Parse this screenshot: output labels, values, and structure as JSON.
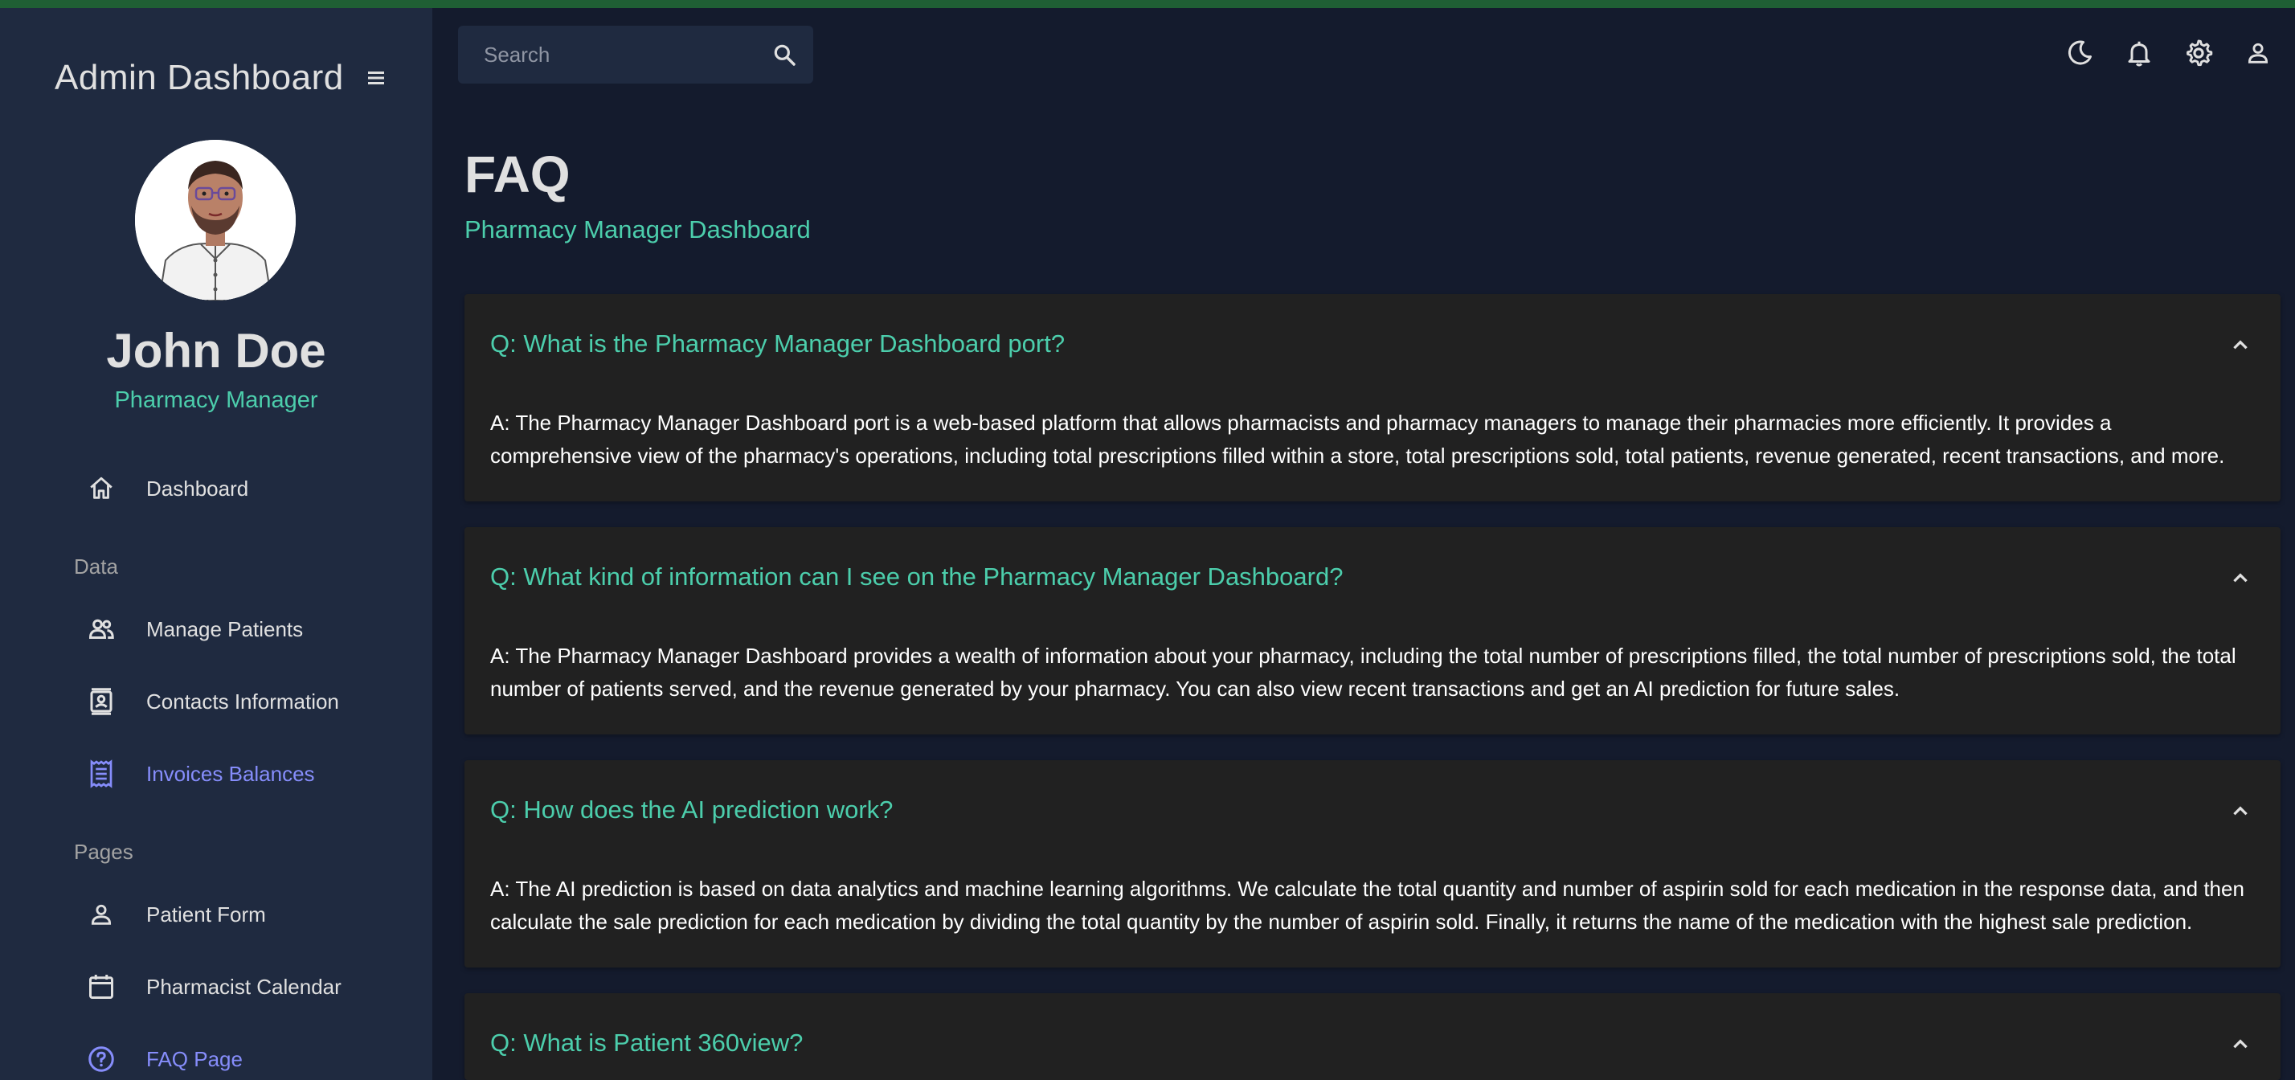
{
  "sidebar": {
    "title": "Admin Dashboard",
    "user": {
      "name": "John Doe",
      "role": "Pharmacy Manager"
    },
    "nav": {
      "dashboard": "Dashboard",
      "section_data": "Data",
      "manage_patients": "Manage Patients",
      "contacts": "Contacts Information",
      "invoices": "Invoices Balances",
      "section_pages": "Pages",
      "patient_form": "Patient Form",
      "calendar": "Pharmacist Calendar",
      "faq": "FAQ Page"
    },
    "active_item": "Invoices Balances"
  },
  "topbar": {
    "search_placeholder": "Search",
    "icons": [
      "moon-icon",
      "bell-icon",
      "gear-icon",
      "person-icon"
    ]
  },
  "header": {
    "title": "FAQ",
    "subtitle": "Pharmacy Manager Dashboard"
  },
  "faqs": [
    {
      "question": "Q: What is the Pharmacy Manager Dashboard port?",
      "answer": "A: The Pharmacy Manager Dashboard port is a web-based platform that allows pharmacists and pharmacy managers to manage their pharmacies more efficiently. It provides a comprehensive view of the pharmacy's operations, including total prescriptions filled within a store, total prescriptions sold, total patients, revenue generated, recent transactions, and more."
    },
    {
      "question": "Q: What kind of information can I see on the Pharmacy Manager Dashboard?",
      "answer": "A: The Pharmacy Manager Dashboard provides a wealth of information about your pharmacy, including the total number of prescriptions filled, the total number of prescriptions sold, the total number of patients served, and the revenue generated by your pharmacy. You can also view recent transactions and get an AI prediction for future sales."
    },
    {
      "question": "Q: How does the AI prediction work?",
      "answer": "A: The AI prediction is based on data analytics and machine learning algorithms. We calculate the total quantity and number of aspirin sold for each medication in the response data, and then calculate the sale prediction for each medication by dividing the total quantity by the number of aspirin sold. Finally, it returns the name of the medication with the highest sale prediction."
    },
    {
      "question": "Q: What is Patient 360view?",
      "answer": ""
    }
  ],
  "colors": {
    "background": "#141b2d",
    "sidebar": "#1f2a40",
    "accent_green": "#4cceac",
    "accent_purple": "#868dfb",
    "card": "#212121"
  }
}
